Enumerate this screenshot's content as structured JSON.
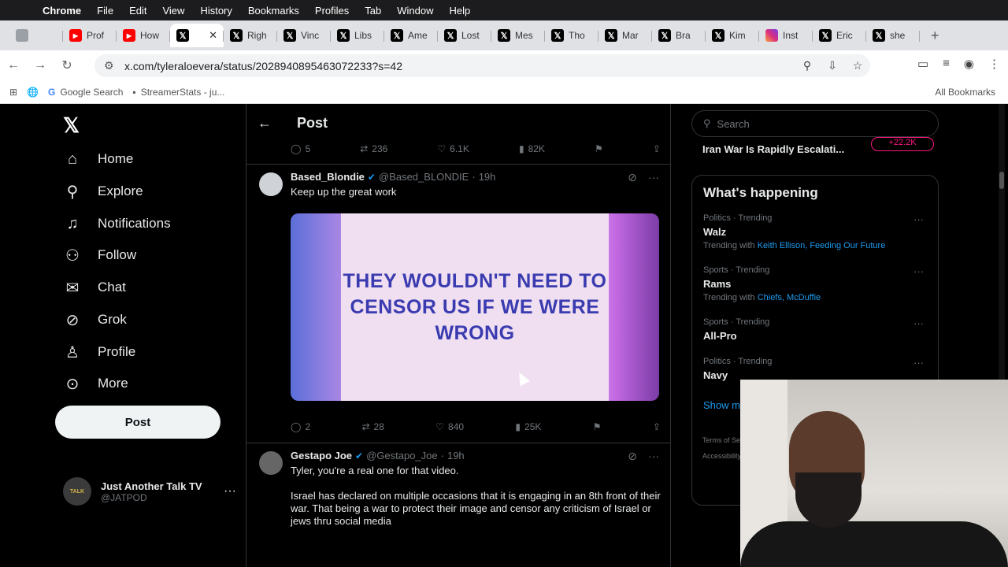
{
  "menubar": {
    "app": "Chrome",
    "items": [
      "File",
      "Edit",
      "View",
      "History",
      "Bookmarks",
      "Profiles",
      "Tab",
      "Window",
      "Help"
    ]
  },
  "tabs": [
    {
      "icon": "gray",
      "title": ""
    },
    {
      "icon": "yt",
      "title": "Prof"
    },
    {
      "icon": "yt",
      "title": "How"
    },
    {
      "icon": "x",
      "title": ""
    },
    {
      "icon": "x",
      "title": "Righ"
    },
    {
      "icon": "x",
      "title": "Vinc"
    },
    {
      "icon": "x",
      "title": "Libs"
    },
    {
      "icon": "x",
      "title": "Ame"
    },
    {
      "icon": "x",
      "title": "Lost"
    },
    {
      "icon": "x",
      "title": "Mes"
    },
    {
      "icon": "x",
      "title": "Tho"
    },
    {
      "icon": "x",
      "title": "Mar"
    },
    {
      "icon": "x",
      "title": "Bra"
    },
    {
      "icon": "x",
      "title": "Kim"
    },
    {
      "icon": "ig",
      "title": "Inst"
    },
    {
      "icon": "x",
      "title": "Eric"
    },
    {
      "icon": "x",
      "title": "she"
    }
  ],
  "address": {
    "url": "x.com/tyleraloevera/status/2028940895463072233?s=42"
  },
  "bookmarks": {
    "items": [
      "Google Search",
      "StreamerStats - ju..."
    ],
    "all": "All Bookmarks"
  },
  "sidebar": {
    "items": [
      {
        "icon": "home-icon",
        "label": "Home"
      },
      {
        "icon": "search-icon",
        "label": "Explore"
      },
      {
        "icon": "bell-icon",
        "label": "Notifications"
      },
      {
        "icon": "follow-icon",
        "label": "Follow"
      },
      {
        "icon": "mail-icon",
        "label": "Chat"
      },
      {
        "icon": "grok-icon",
        "label": "Grok"
      },
      {
        "icon": "person-icon",
        "label": "Profile"
      },
      {
        "icon": "more-icon",
        "label": "More"
      }
    ],
    "post_label": "Post",
    "account": {
      "name": "Just Another Talk TV",
      "handle": "@JATPOD",
      "avatar_text": "TALK"
    }
  },
  "header": {
    "title": "Post"
  },
  "prev_actions": {
    "replies": "5",
    "reposts": "236",
    "likes": "6.1K",
    "views": "82K"
  },
  "tweets": [
    {
      "name": "Based_Blondie",
      "handle": "@Based_BLONDIE",
      "time": "19h",
      "text": "Keep up the great work",
      "media_text": "THEY WOULDN'T NEED TO CENSOR US IF WE WERE WRONG",
      "replies": "2",
      "reposts": "28",
      "likes": "840",
      "views": "25K"
    },
    {
      "name": "Gestapo Joe",
      "handle": "@Gestapo_Joe",
      "time": "19h",
      "text1": "Tyler, you're a real one for that video.",
      "text2": "Israel has declared on multiple occasions that it is engaging in an 8th front of their war. That being a war to protect their image and censor any criticism of Israel or jews thru social media"
    }
  ],
  "right": {
    "search_placeholder": "Search",
    "news_headline": "Iran War Is Rapidly Escalati...",
    "news_badge": "+22.2K",
    "happening_title": "What's happening",
    "trends": [
      {
        "context": "Politics · Trending",
        "name": "Walz",
        "with_label": "Trending with",
        "with": "Keith Ellison, Feeding Our Future"
      },
      {
        "context": "Sports · Trending",
        "name": "Rams",
        "with_label": "Trending with",
        "with": "Chiefs, McDuffie"
      },
      {
        "context": "Sports · Trending",
        "name": "All-Pro",
        "with_label": "",
        "with": ""
      },
      {
        "context": "Politics · Trending",
        "name": "Navy",
        "with_label": "",
        "with": ""
      }
    ],
    "show_more": "Show more",
    "footer1": "Terms of Service",
    "footer2": "Accessibility"
  }
}
